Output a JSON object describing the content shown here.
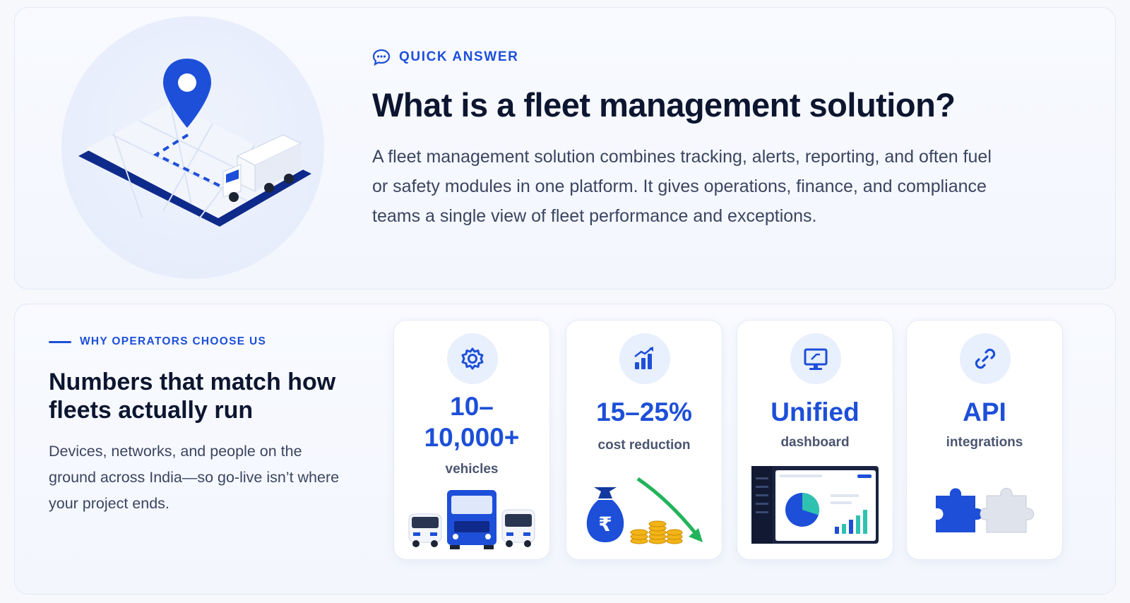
{
  "quick_answer": {
    "label": "QUICK ANSWER",
    "title": "What is a fleet management solution?",
    "body": "A fleet management solution combines tracking, alerts, reporting, and often fuel or safety modules in one platform. It gives operations, finance, and compliance teams a single view of fleet performance and exceptions."
  },
  "why": {
    "label": "WHY OPERATORS CHOOSE US",
    "title": "Numbers that match how fleets actually run",
    "body": "Devices, networks, and people on the ground across India—so go-live isn’t where your project ends."
  },
  "stats": [
    {
      "icon": "gear-icon",
      "value_line1": "10–",
      "value_line2": "10,000+",
      "unit": "vehicles"
    },
    {
      "icon": "bar-chart-icon",
      "value": "15–25%",
      "unit": "cost reduction"
    },
    {
      "icon": "monitor-icon",
      "value": "Unified",
      "unit": "dashboard"
    },
    {
      "icon": "link-icon",
      "value": "API",
      "unit": "integrations"
    }
  ],
  "dashboard_art": {
    "pie_share": 0.3
  },
  "colors": {
    "accent": "#1d4fd8",
    "heading": "#0d1630",
    "body": "#3b4560",
    "green_arrow": "#22b45a",
    "coin_gold": "#f2b417"
  }
}
